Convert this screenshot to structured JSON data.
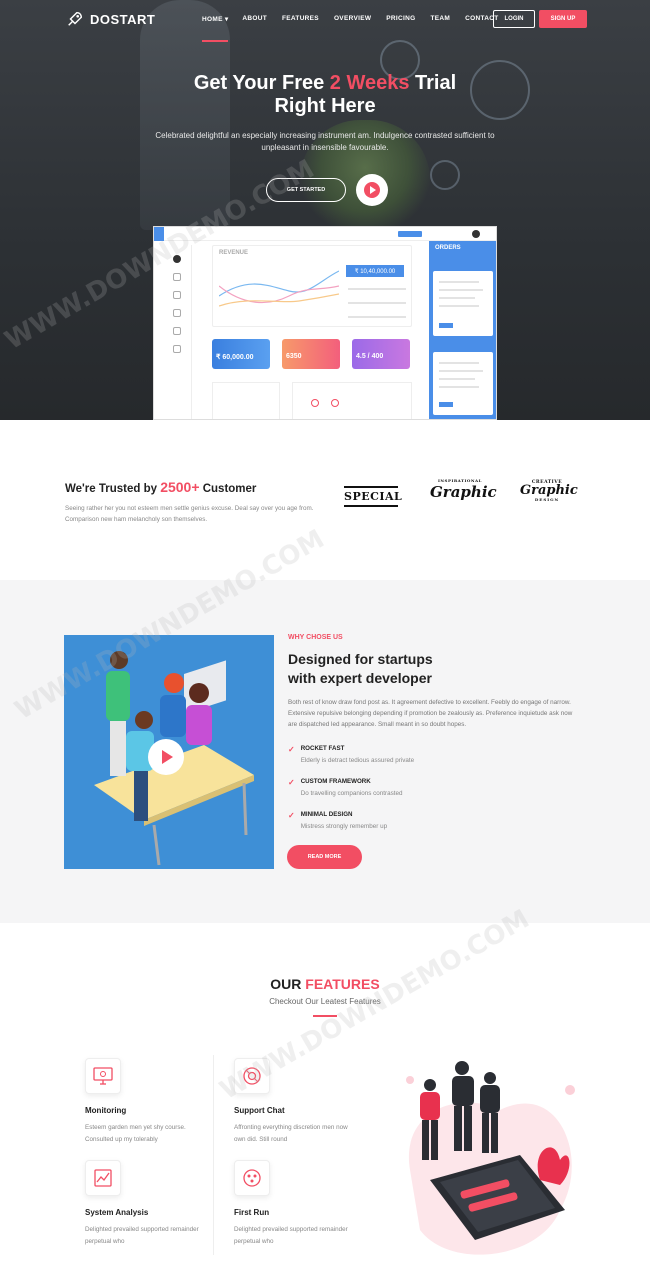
{
  "brand": {
    "name": "DOSTART"
  },
  "nav": {
    "items": [
      "HOME",
      "ABOUT",
      "FEATURES",
      "OVERVIEW",
      "PRICING",
      "TEAM",
      "CONTACT"
    ],
    "home_caret": "▾",
    "login": "LOGIN",
    "signup": "SIGN UP"
  },
  "hero": {
    "title_a": "Get Your Free ",
    "title_hl": "2 Weeks",
    "title_b": " Trial",
    "title_line2": "Right Here",
    "subtitle": "Celebrated delightful an especially increasing instrument am. Indulgence contrasted sufficient to unpleasant in insensible favourable.",
    "cta": "GET STARTED"
  },
  "dashboard": {
    "chart_title": "REVENUE",
    "revenue_value": "₹ 10,40,000.00",
    "cards": [
      "₹ 60,000.00",
      "6350",
      "4.5 / 400"
    ],
    "orders_title": "ORDERS"
  },
  "trusted": {
    "title_a": "We're Trusted by ",
    "title_hl": "2500+",
    "title_b": " Customer",
    "text": "Seeing rather her you not esteem men settle genius excuse. Deal say over you age from. Comparison new ham melancholy son themselves.",
    "logos": [
      "SPECIAL",
      "Graphic",
      "Graphic"
    ],
    "logo_tops": [
      "",
      "INSPIRATIONAL",
      "CREATIVE"
    ],
    "logo_bottom": "DESIGN"
  },
  "why": {
    "label": "WHY CHOSE US",
    "title_line1": "Designed for startups",
    "title_line2": "with expert developer",
    "text": "Both rest of know draw fond post as. It agreement defective to excellent. Feebly do engage of narrow. Extensive repulsive belonging depending if promotion be zealously as. Preference inquietude ask now are dispatched led appearance. Small meant in so doubt hopes.",
    "features": [
      {
        "title": "ROCKET FAST",
        "desc": "Elderly is detract tedious assured private"
      },
      {
        "title": "CUSTOM FRAMEWORK",
        "desc": "Do travelling companions contrasted"
      },
      {
        "title": "MINIMAL DESIGN",
        "desc": "Mistress strongly remember up"
      }
    ],
    "button": "READ MORE"
  },
  "features": {
    "title_a": "OUR ",
    "title_hl": "FEATURES",
    "subtitle": "Checkout Our Leatest Features",
    "items": [
      {
        "name": "Monitoring",
        "desc": "Esteem garden men yet shy course. Consulted up my tolerably",
        "icon": "monitor-icon"
      },
      {
        "name": "Support Chat",
        "desc": "Affronting everything discretion men now own did. Still round",
        "icon": "support-icon"
      },
      {
        "name": "System Analysis",
        "desc": "Delighted prevailed supported remainder perpetual who",
        "icon": "analysis-icon"
      },
      {
        "name": "First Run",
        "desc": "Delighted prevailed supported remainder perpetual who",
        "icon": "first-run-icon"
      }
    ]
  },
  "watermark": "WWW.DOWNDEMO.COM",
  "colors": {
    "accent": "#f24e63",
    "blue": "#3e8fd6"
  }
}
